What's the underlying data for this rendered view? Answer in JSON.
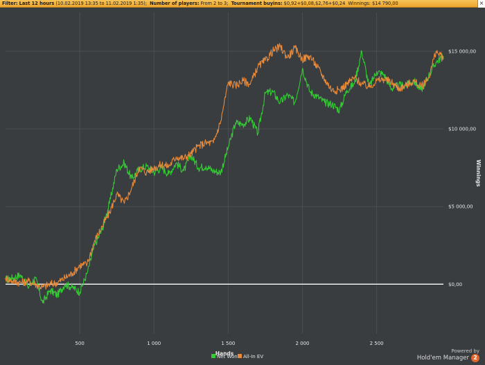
{
  "filter": {
    "label": "Filter:",
    "items": [
      {
        "key": "Last 12 hours",
        "value": "(10.02.2019 13:35 to 11.02.2019 1:35);"
      },
      {
        "key": "Number of players:",
        "value": "From 2 to 3;"
      },
      {
        "key": "Tournament buyins:",
        "value": "$0,92+$0,08,$2,76+$0,24"
      },
      {
        "key": "Winnings:",
        "value": "$14 790,00"
      }
    ],
    "close_label": "×"
  },
  "branding": {
    "powered_by": "Powered by",
    "name": "Hold'em Manager",
    "logo_glyph": "2"
  },
  "chart_data": {
    "type": "line",
    "xlabel": "Hands",
    "ylabel": "Winnings",
    "xlim": [
      0,
      2950
    ],
    "ylim": [
      -3200,
      17500
    ],
    "x_ticks": [
      500,
      1000,
      1500,
      2000,
      2500
    ],
    "x_tick_labels": [
      "500",
      "1 000",
      "1 500",
      "2 000",
      "2 500"
    ],
    "y_ticks": [
      0,
      5000,
      10000,
      15000
    ],
    "y_tick_labels": [
      "$0,00",
      "$5 000,00",
      "$10 000,00",
      "$15 000,00"
    ],
    "grid": true,
    "legend_position": "bottom-center",
    "colors": {
      "background": "#3a3d40",
      "grid": "#4a4e52",
      "zero_line": "#ffffff",
      "text": "#e6e6e6"
    },
    "series": [
      {
        "name": "Net Won",
        "color": "#33cc33",
        "x": [
          0,
          50,
          100,
          150,
          200,
          250,
          300,
          350,
          400,
          450,
          500,
          550,
          600,
          650,
          700,
          750,
          800,
          850,
          900,
          950,
          1000,
          1050,
          1100,
          1150,
          1200,
          1250,
          1300,
          1350,
          1400,
          1450,
          1500,
          1550,
          1600,
          1650,
          1700,
          1750,
          1800,
          1850,
          1900,
          1950,
          2000,
          2050,
          2100,
          2150,
          2200,
          2250,
          2300,
          2350,
          2400,
          2450,
          2500,
          2550,
          2600,
          2650,
          2700,
          2750,
          2800,
          2850,
          2900,
          2950
        ],
        "values": [
          300,
          400,
          600,
          -200,
          400,
          -1200,
          -400,
          -700,
          0,
          -200,
          -500,
          700,
          2500,
          3500,
          5200,
          7400,
          7800,
          6800,
          7400,
          7600,
          7200,
          7500,
          7100,
          7800,
          7300,
          8300,
          7500,
          7600,
          7300,
          7200,
          8800,
          10400,
          10300,
          10700,
          9700,
          12300,
          12400,
          11700,
          12200,
          11700,
          13900,
          12400,
          12100,
          11700,
          11600,
          11200,
          12500,
          12900,
          15000,
          12700,
          13700,
          13500,
          12600,
          12800,
          12800,
          13100,
          12500,
          13400,
          14300,
          14700
        ]
      },
      {
        "name": "All-In EV",
        "color": "#e88a3a",
        "x": [
          0,
          50,
          100,
          150,
          200,
          250,
          300,
          350,
          400,
          450,
          500,
          550,
          600,
          650,
          700,
          750,
          800,
          850,
          900,
          950,
          1000,
          1050,
          1100,
          1150,
          1200,
          1250,
          1300,
          1350,
          1400,
          1450,
          1500,
          1550,
          1600,
          1650,
          1700,
          1750,
          1800,
          1850,
          1900,
          1950,
          2000,
          2050,
          2100,
          2150,
          2200,
          2250,
          2300,
          2350,
          2400,
          2450,
          2500,
          2550,
          2600,
          2650,
          2700,
          2750,
          2800,
          2850,
          2900,
          2950
        ],
        "values": [
          400,
          200,
          100,
          200,
          0,
          -200,
          0,
          100,
          400,
          700,
          1200,
          1300,
          2800,
          3700,
          4600,
          5800,
          5200,
          6200,
          7500,
          7200,
          7500,
          7700,
          7600,
          8200,
          8100,
          8400,
          8900,
          9100,
          9100,
          10500,
          13000,
          12800,
          13100,
          12900,
          14000,
          14400,
          15000,
          15300,
          14600,
          15200,
          14500,
          14700,
          14000,
          13200,
          12500,
          12500,
          12900,
          13300,
          12900,
          12700,
          13100,
          13200,
          13000,
          12600,
          12800,
          13100,
          12700,
          13300,
          15000,
          14500
        ]
      }
    ]
  }
}
